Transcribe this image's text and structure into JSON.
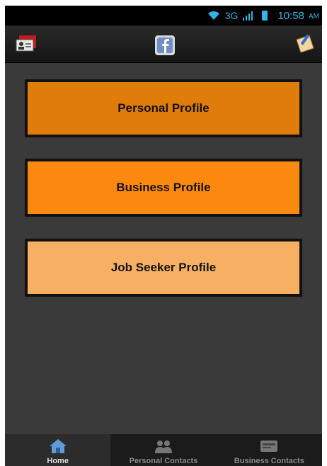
{
  "status_bar": {
    "network": "3G",
    "time": "10:58",
    "ampm": "AM"
  },
  "action_bar": {
    "left_icon": "contact-card-icon",
    "center_icon": "facebook-icon",
    "right_icon": "edit-note-icon"
  },
  "profiles": {
    "personal": "Personal Profile",
    "business": "Business Profile",
    "jobseeker": "Job Seeker Profile"
  },
  "tabs": [
    {
      "label": "Home",
      "icon": "home-icon",
      "active": true
    },
    {
      "label": "Personal Contacts",
      "icon": "people-icon",
      "active": false
    },
    {
      "label": "Business Contacts",
      "icon": "card-icon",
      "active": false
    }
  ],
  "colors": {
    "personal": "#e07d0a",
    "business": "#fb890f",
    "jobseeker": "#f7b063",
    "status_accent": "#33b5e5"
  }
}
